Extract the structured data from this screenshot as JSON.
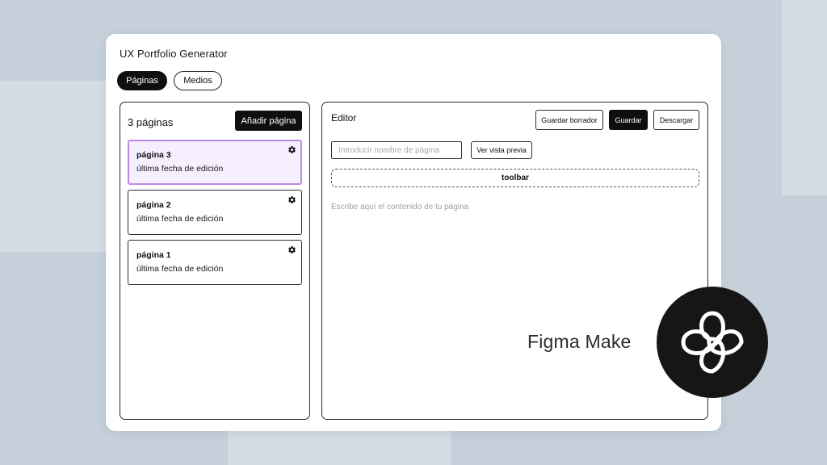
{
  "app": {
    "title": "UX Portfolio Generator",
    "tabs": [
      {
        "label": "Páginas",
        "active": true
      },
      {
        "label": "Medios",
        "active": false
      }
    ]
  },
  "pages_panel": {
    "count_label": "3 páginas",
    "add_button": "Añadir página",
    "pages": [
      {
        "title": "página 3",
        "subtitle": "última fecha de edición",
        "selected": true,
        "icon": "gear-icon"
      },
      {
        "title": "página 2",
        "subtitle": "última fecha de edición",
        "selected": false,
        "icon": "gear-icon"
      },
      {
        "title": "página 1",
        "subtitle": "última fecha de edición",
        "selected": false,
        "icon": "gear-icon"
      }
    ]
  },
  "editor": {
    "title": "Editor",
    "buttons": {
      "draft": "Guardar borrador",
      "save": "Guardar",
      "download": "Descargar"
    },
    "name_input": {
      "value": "",
      "placeholder": "Introducir nombre de página"
    },
    "preview_button": "Ver vista previa",
    "toolbar_label": "toolbar",
    "content_placeholder": "Escribe aquí el contenido de tu página"
  },
  "branding": {
    "text": "Figma Make",
    "logo_icon": "figma-make-logo-icon"
  },
  "colors": {
    "background": "#c5d0da",
    "accent_dark": "#0f0f0f",
    "selected_card_bg": "#f6efff",
    "selected_card_border": "#b98be6"
  }
}
